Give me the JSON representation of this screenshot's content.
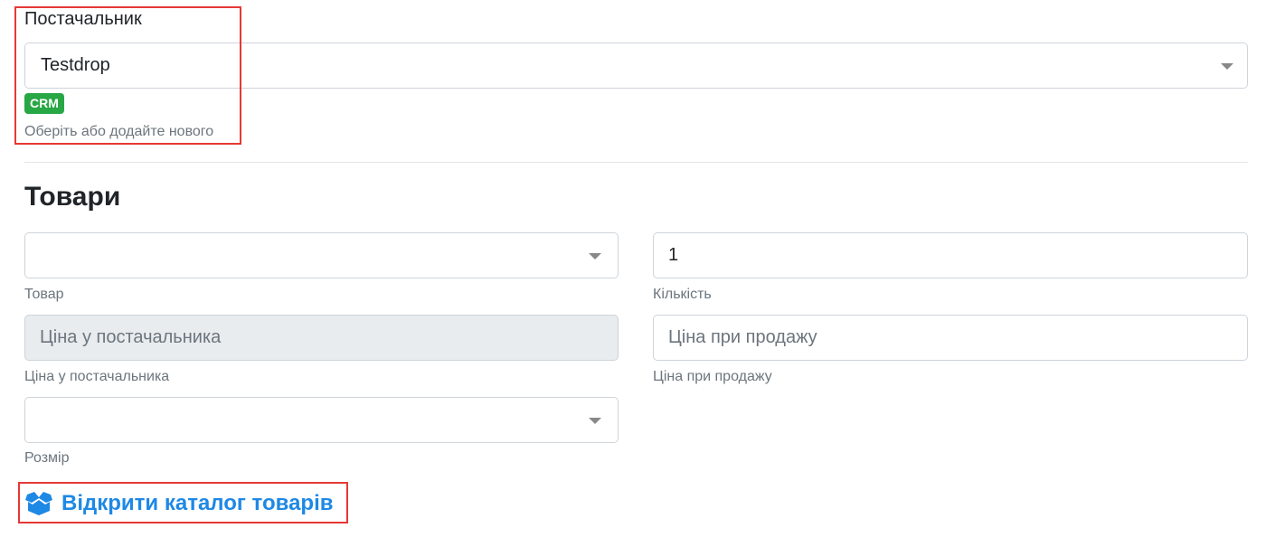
{
  "supplier": {
    "label": "Постачальник",
    "selected": "Testdrop",
    "badge": "CRM",
    "help": "Оберіть або додайте нового"
  },
  "products": {
    "title": "Товари",
    "product_select": {
      "value": "",
      "label": "Товар"
    },
    "quantity": {
      "value": "1",
      "label": "Кількість"
    },
    "supplier_price": {
      "placeholder": "Ціна у постачальника",
      "label": "Ціна у постачальника"
    },
    "sale_price": {
      "placeholder": "Ціна при продажу",
      "label": "Ціна при продажу"
    },
    "size_select": {
      "value": "",
      "label": "Розмір"
    },
    "catalog_link": "Відкрити каталог товарів"
  },
  "colors": {
    "accent": "#1e88e5",
    "badge": "#28a745",
    "highlight": "#e53935"
  }
}
